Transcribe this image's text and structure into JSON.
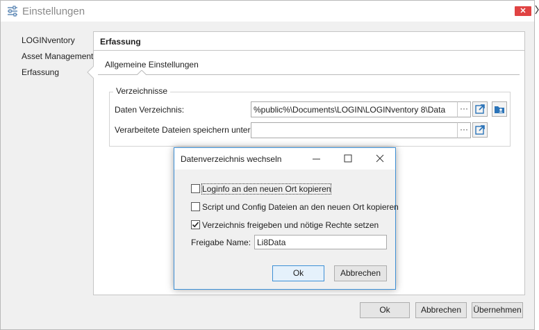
{
  "window": {
    "title": "Einstellungen",
    "close_label": "✕"
  },
  "sidebar": {
    "items": [
      {
        "label": "LOGINventory"
      },
      {
        "label": "Asset Management"
      },
      {
        "label": "Erfassung"
      }
    ],
    "selected": "Erfassung"
  },
  "panel": {
    "title": "Erfassung",
    "tab": "Allgemeine Einstellungen",
    "group_title": "Verzeichnisse",
    "fields": [
      {
        "label": "Daten Verzeichnis:",
        "value": "%public%\\Documents\\LOGIN\\LOGINventory 8\\Data"
      },
      {
        "label": "Verarbeitete Dateien speichern unter:",
        "value": ""
      }
    ],
    "browse_label": "···"
  },
  "footer": {
    "ok": "Ok",
    "cancel": "Abbrechen",
    "apply": "Übernehmen"
  },
  "dialog": {
    "title": "Datenverzeichnis wechseln",
    "options": [
      {
        "label": "Loginfo an den neuen Ort kopieren",
        "checked": false
      },
      {
        "label": "Script und Config Dateien an den neuen Ort kopieren",
        "checked": false
      },
      {
        "label": "Verzeichnis freigeben und nötige Rechte setzen",
        "checked": true
      }
    ],
    "share_label": "Freigabe Name:",
    "share_value": "Li8Data",
    "ok": "Ok",
    "cancel": "Abbrechen"
  },
  "colors": {
    "accent": "#3c8fd6",
    "close_button": "#e04343",
    "folder_icon": "#2a73b8"
  },
  "icons": [
    "settings-sliders-icon",
    "open-external-icon",
    "folder-share-icon",
    "minimize-icon",
    "maximize-icon",
    "close-icon",
    "checkmark-icon"
  ]
}
